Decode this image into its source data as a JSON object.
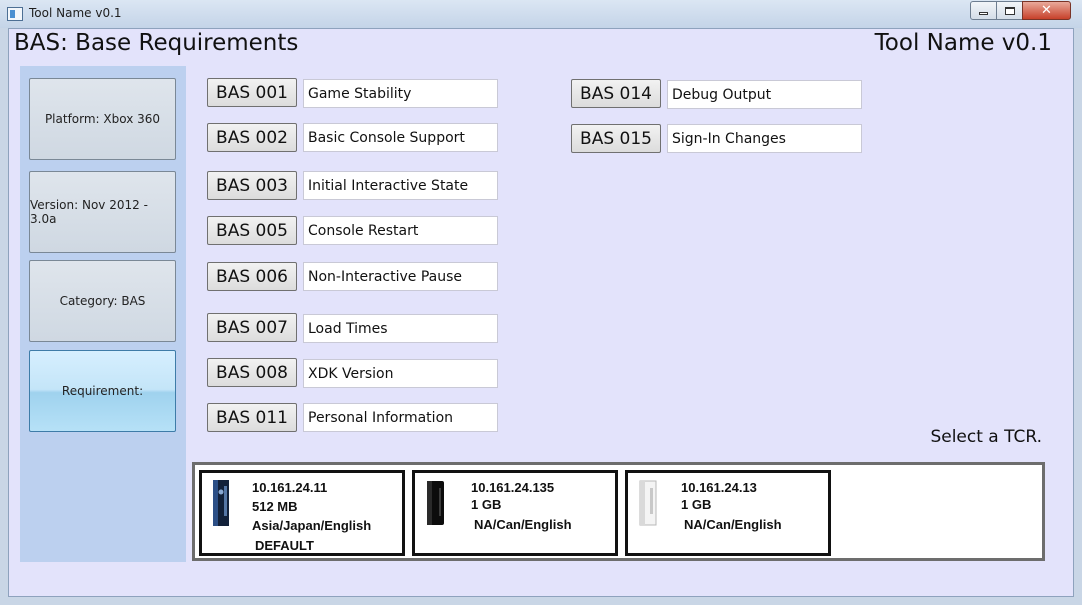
{
  "window": {
    "title": "Tool Name v0.1",
    "minimize": "",
    "maximize": "",
    "close": "✕"
  },
  "header": {
    "page_title": "BAS: Base Requirements",
    "tool_name": "Tool Name v0.1"
  },
  "sidebar": {
    "items": [
      {
        "label": "Platform: Xbox 360"
      },
      {
        "label": "Version: Nov 2012 - 3.0a"
      },
      {
        "label": "Category: BAS"
      },
      {
        "label": "Requirement:"
      }
    ]
  },
  "requirements": {
    "left": [
      {
        "code": "BAS 001",
        "name": "Game Stability"
      },
      {
        "code": "BAS 002",
        "name": "Basic Console Support"
      },
      {
        "code": "BAS 003",
        "name": "Initial Interactive State"
      },
      {
        "code": "BAS 005",
        "name": "Console Restart"
      },
      {
        "code": "BAS 006",
        "name": "Non-Interactive Pause"
      },
      {
        "code": "BAS 007",
        "name": "Load Times"
      },
      {
        "code": "BAS 008",
        "name": "XDK Version"
      },
      {
        "code": "BAS 011",
        "name": "Personal Information"
      }
    ],
    "right": [
      {
        "code": "BAS 014",
        "name": "Debug Output"
      },
      {
        "code": "BAS 015",
        "name": "Sign-In Changes"
      }
    ]
  },
  "prompt": "Select a TCR.",
  "consoles": [
    {
      "ip": "10.161.24.11",
      "memory": "512 MB",
      "region": "Asia/Japan/English",
      "tag": "DEFAULT",
      "icon": "xbox360-elite-icon"
    },
    {
      "ip": "10.161.24.135",
      "memory": "1 GB",
      "region": "NA/Can/English",
      "tag": "",
      "icon": "xbox360-slim-black-icon"
    },
    {
      "ip": "10.161.24.13",
      "memory": "1 GB",
      "region": "NA/Can/English",
      "tag": "",
      "icon": "xbox360-white-icon"
    }
  ]
}
